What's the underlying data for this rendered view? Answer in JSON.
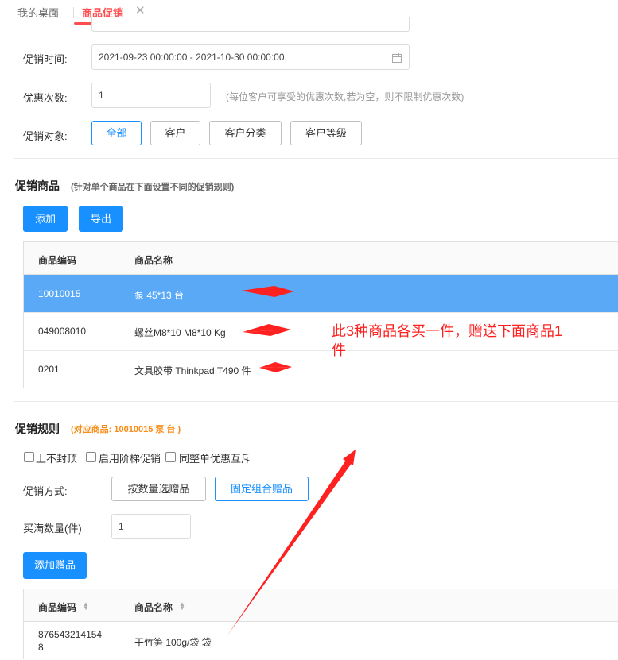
{
  "tabs": {
    "desk": "我的桌面",
    "promo": "商品促销",
    "close": "✕"
  },
  "form": {
    "time_label": "促销时间:",
    "time_value": "2021-09-23 00:00:00 - 2021-10-30 00:00:00",
    "count_label": "优惠次数:",
    "count_value": "1",
    "count_hint": "(每位客户可享受的优惠次数,若为空，则不限制优惠次数)",
    "target_label": "促销对象:",
    "targets": [
      "全部",
      "客户",
      "客户分类",
      "客户等级"
    ]
  },
  "goods": {
    "title": "促销商品",
    "subtitle": "(针对单个商品在下面设置不同的促销规则)",
    "add_label": "添加",
    "export_label": "导出",
    "col_code": "商品编码",
    "col_name": "商品名称",
    "rows": [
      {
        "code": "10010015",
        "name": "泵 45*13 台"
      },
      {
        "code": "049008010",
        "name": "螺丝M8*10 M8*10 Kg"
      },
      {
        "code": "0201",
        "name": "文具胶带 Thinkpad T490 件"
      }
    ]
  },
  "annotation": {
    "line1": "此3种商品各买一件，赠送下面商品1",
    "line2": "件"
  },
  "rules": {
    "title": "促销规则",
    "subtitle": "(对应商品: 10010015 泵 台 )",
    "options": [
      "上不封顶",
      "启用阶梯促销",
      "同整单优惠互斥"
    ],
    "method_label": "促销方式:",
    "method_qty": "按数量选赠品",
    "method_fixed": "固定组合赠品",
    "min_qty_label": "买满数量(件)",
    "min_qty_value": "1",
    "add_gift_label": "添加赠品",
    "col_code": "商品编码",
    "col_name": "商品名称",
    "gift_rows": [
      {
        "code_line1": "876543214154",
        "code_line2": "8",
        "name": "干竹笋 100g/袋 袋"
      }
    ]
  },
  "colors": {
    "accent": "#1890ff",
    "tab_active": "#ff4d4f",
    "annotation": "#ff2020",
    "sub_orange": "#fa8c16"
  }
}
